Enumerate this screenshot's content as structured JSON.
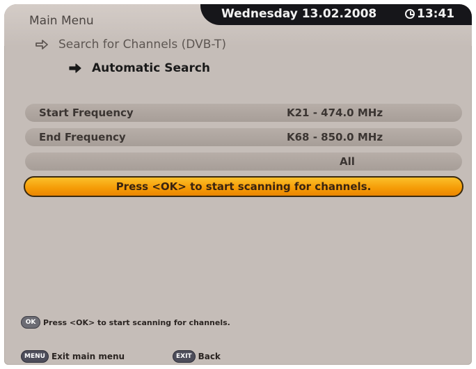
{
  "header": {
    "menu_title": "Main Menu",
    "date": "Wednesday 13.02.2008",
    "time": "13:41"
  },
  "breadcrumb": {
    "level1": "Search for Channels (DVB-T)",
    "level2": "Automatic Search"
  },
  "settings": [
    {
      "label": "Start Frequency",
      "value": "K21 - 474.0 MHz"
    },
    {
      "label": "End Frequency",
      "value": "K68 - 850.0 MHz"
    },
    {
      "label": "",
      "value": "All"
    }
  ],
  "action": {
    "label": "Press <OK> to start scanning for channels."
  },
  "help": {
    "ok_key": "OK",
    "text": "Press <OK> to start scanning for channels."
  },
  "footer": {
    "menu_key": "MENU",
    "menu_label": "Exit main menu",
    "exit_key": "EXIT",
    "exit_label": "Back"
  },
  "colors": {
    "background": "#c5bdb8",
    "accent": "#f59b06",
    "clock_bar": "#16161a"
  }
}
